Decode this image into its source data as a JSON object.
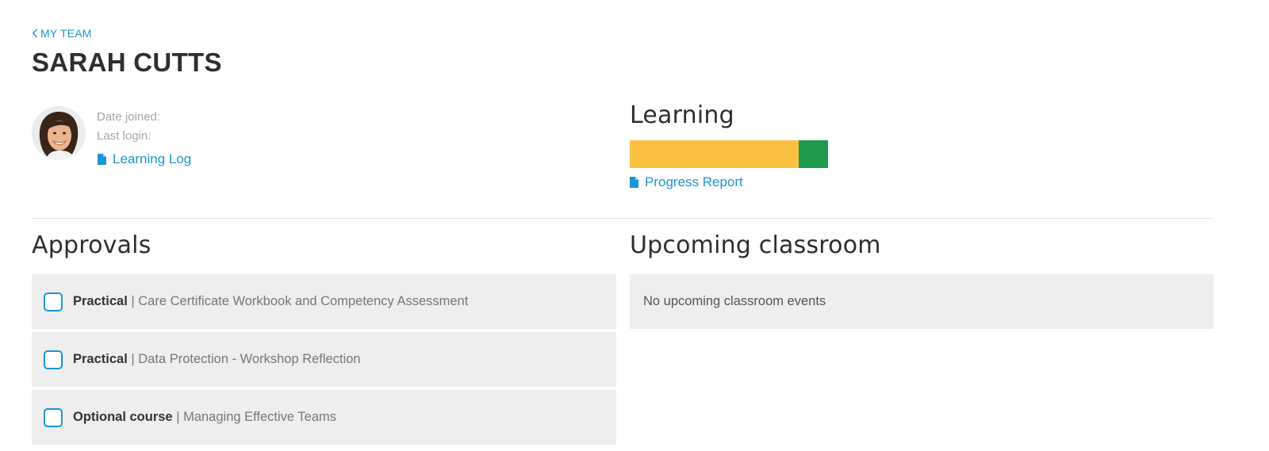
{
  "nav": {
    "back_label": "MY TEAM"
  },
  "profile": {
    "name": "SARAH CUTTS",
    "date_joined_label": "Date joined:",
    "last_login_label": "Last login:",
    "learning_log_label": "Learning Log"
  },
  "learning": {
    "title": "Learning",
    "progress": {
      "in_progress_fraction": 0.85,
      "complete_fraction": 0.15
    },
    "colors": {
      "in_progress": "#fbc140",
      "complete": "#1f9a4f"
    },
    "report_label": "Progress Report"
  },
  "approvals": {
    "title": "Approvals",
    "items": [
      {
        "type": "Practical",
        "separator": " | ",
        "name": "Care Certificate Workbook and Competency Assessment"
      },
      {
        "type": "Practical",
        "separator": " | ",
        "name": "Data Protection - Workshop Reflection"
      },
      {
        "type": "Optional course",
        "separator": " | ",
        "name": "Managing Effective Teams"
      }
    ]
  },
  "upcoming": {
    "title": "Upcoming classroom",
    "empty_message": "No upcoming classroom events"
  },
  "icons": {
    "back": "chevron-left-icon",
    "document": "document-icon",
    "checkbox": "checkbox-icon"
  },
  "accent_color": "#1a96d4"
}
